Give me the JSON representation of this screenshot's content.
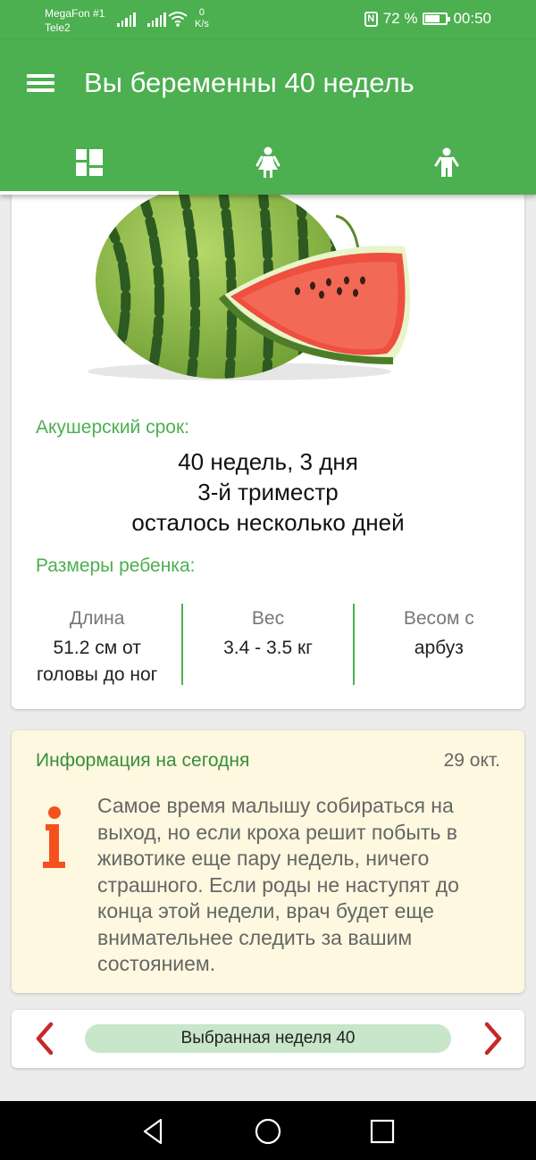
{
  "status_bar": {
    "carrier_1": "MegaFon #1",
    "carrier_2": "Tele2",
    "speed_value": "0",
    "speed_unit": "K/s",
    "battery_percent": "72 %",
    "battery_level": 0.72,
    "time": "00:50"
  },
  "app_bar": {
    "title": "Вы беременны 40 недель",
    "tabs": [
      {
        "icon": "dashboard-icon",
        "active": true
      },
      {
        "icon": "woman-icon",
        "active": false
      },
      {
        "icon": "child-icon",
        "active": false
      }
    ]
  },
  "overview": {
    "fruit_image": "watermelon-illustration",
    "term_label": "Акушерский срок:",
    "term_lines": [
      "40 недель, 3 дня",
      "3-й триместр",
      "осталось несколько дней"
    ],
    "size_label": "Размеры ребенка:",
    "sizes": [
      {
        "header": "Длина",
        "value": "51.2 см от головы до ног"
      },
      {
        "header": "Вес",
        "value": "3.4 - 3.5 кг"
      },
      {
        "header": "Весом с",
        "value": "арбуз"
      }
    ]
  },
  "daily_info": {
    "title": "Информация на сегодня",
    "date": "29 окт.",
    "icon": "info-icon",
    "text": "Самое время малышу собираться на выход, но если кроха решит побыть в животике еще пару недель, ничего страшного. Если роды не наступят до конца этой недели, врач будет еще внимательнее следить за вашим состоянием."
  },
  "week_selector": {
    "label": "Выбранная неделя 40"
  },
  "colors": {
    "primary": "#4caf50",
    "info_background": "#fdf8df",
    "pill_background": "#c8e6c9",
    "arrow": "#c62828",
    "info_icon": "#f4511e"
  }
}
